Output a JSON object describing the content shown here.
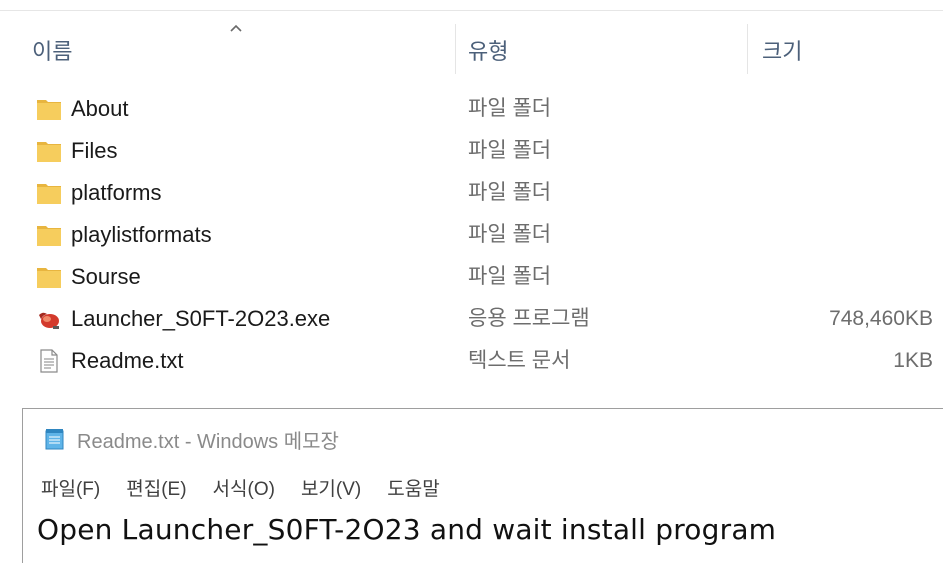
{
  "explorer": {
    "columns": {
      "name": "이름",
      "type": "유형",
      "size": "크기"
    },
    "files": [
      {
        "name": "About",
        "type": "파일 폴더",
        "size": "",
        "icon": "folder-icon"
      },
      {
        "name": "Files",
        "type": "파일 폴더",
        "size": "",
        "icon": "folder-icon"
      },
      {
        "name": "platforms",
        "type": "파일 폴더",
        "size": "",
        "icon": "folder-icon"
      },
      {
        "name": "playlistformats",
        "type": "파일 폴더",
        "size": "",
        "icon": "folder-icon"
      },
      {
        "name": "Sourse",
        "type": "파일 폴더",
        "size": "",
        "icon": "folder-icon"
      },
      {
        "name": "Launcher_S0FT-2O23.exe",
        "type": "응용 프로그램",
        "size": "748,460KB",
        "icon": "exe-app-icon"
      },
      {
        "name": "Readme.txt",
        "type": "텍스트 문서",
        "size": "1KB",
        "icon": "text-file-icon"
      }
    ]
  },
  "notepad": {
    "title": "Readme.txt - Windows 메모장",
    "menu": [
      "파일(F)",
      "편집(E)",
      "서식(O)",
      "보기(V)",
      "도움말"
    ],
    "content": "Open Launcher_S0FT-2O23 and wait install program"
  },
  "colors": {
    "folder": "#f6cd5d",
    "header_text": "#4c607a",
    "secondary_text": "#6d6d6d"
  }
}
